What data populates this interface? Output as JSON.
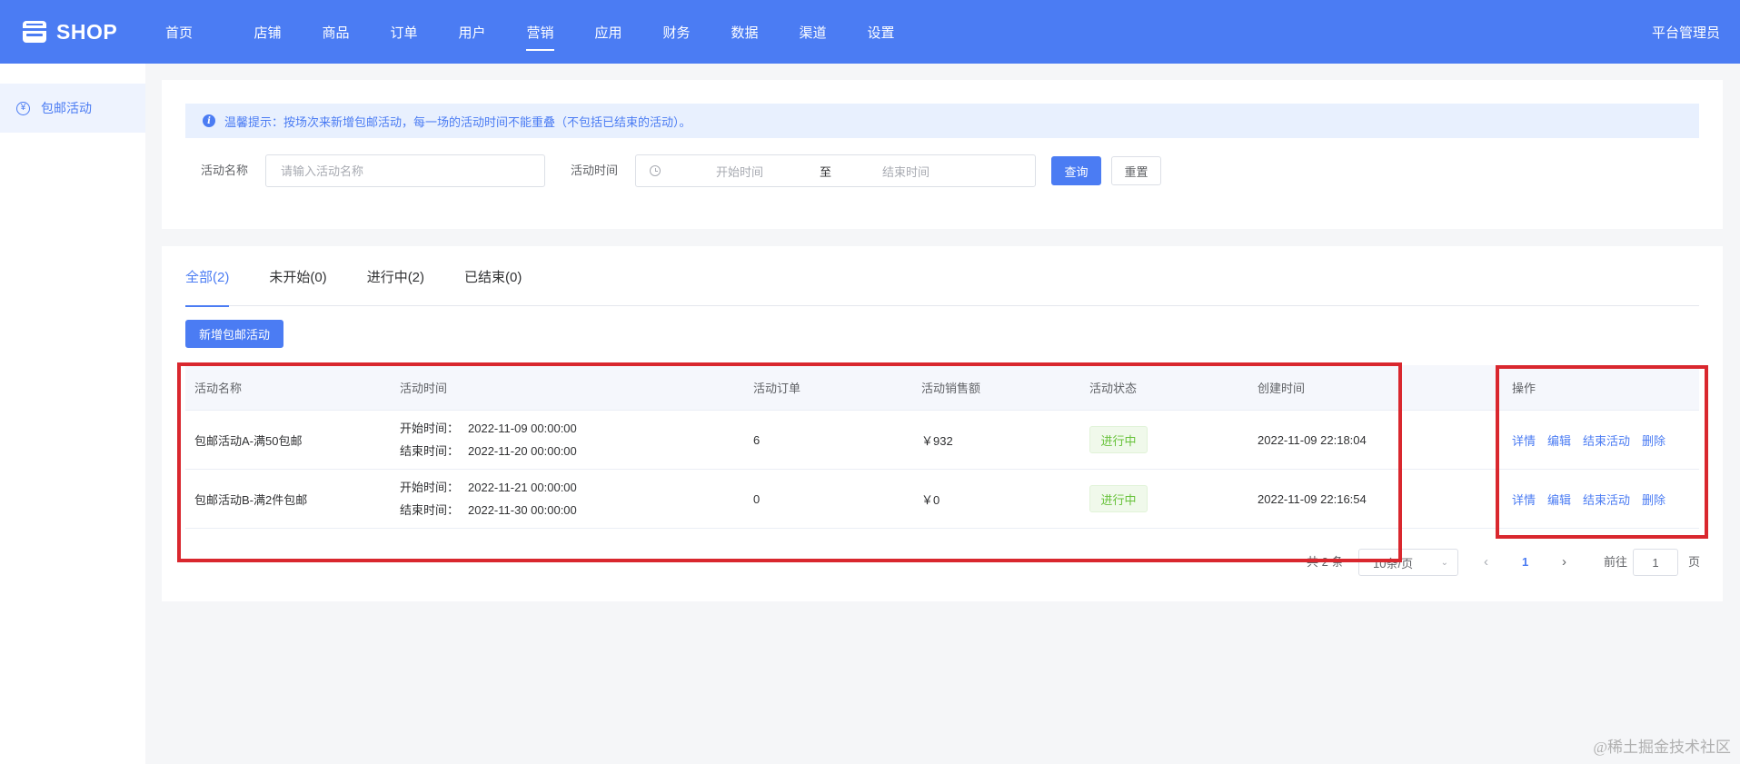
{
  "app": {
    "logo_text": "SHOP",
    "admin_label": "平台管理员",
    "colors": {
      "primary": "#4b7cf3",
      "success": "#67c23a",
      "annotation": "#d9272e"
    }
  },
  "nav": {
    "items": [
      "首页",
      "店铺",
      "商品",
      "订单",
      "用户",
      "营销",
      "应用",
      "财务",
      "数据",
      "渠道",
      "设置"
    ],
    "active": "营销"
  },
  "sidebar": {
    "items": [
      {
        "label": "包邮活动",
        "icon": "yen-circle-icon",
        "active": true
      }
    ]
  },
  "filter": {
    "tip": "温馨提示：按场次来新增包邮活动，每一场的活动时间不能重叠（不包括已结束的活动）。",
    "name_label": "活动名称",
    "name_placeholder": "请输入活动名称",
    "time_label": "活动时间",
    "start_placeholder": "开始时间",
    "range_sep": "至",
    "end_placeholder": "结束时间",
    "query_button": "查询",
    "reset_button": "重置"
  },
  "tabs": [
    {
      "label": "全部(2)",
      "active": true
    },
    {
      "label": "未开始(0)",
      "active": false
    },
    {
      "label": "进行中(2)",
      "active": false
    },
    {
      "label": "已结束(0)",
      "active": false
    }
  ],
  "add_button": "新增包邮活动",
  "table": {
    "columns": [
      "活动名称",
      "活动时间",
      "活动订单",
      "活动销售额",
      "活动状态",
      "创建时间",
      "操作"
    ],
    "start_prefix": "开始时间：",
    "end_prefix": "结束时间：",
    "rows": [
      {
        "name": "包邮活动A-满50包邮",
        "start": "2022-11-09 00:00:00",
        "end": "2022-11-20 00:00:00",
        "orders": "6",
        "sales": "￥932",
        "status": "进行中",
        "created": "2022-11-09 22:18:04",
        "actions": [
          "详情",
          "编辑",
          "结束活动",
          "删除"
        ]
      },
      {
        "name": "包邮活动B-满2件包邮",
        "start": "2022-11-21 00:00:00",
        "end": "2022-11-30 00:00:00",
        "orders": "0",
        "sales": "￥0",
        "status": "进行中",
        "created": "2022-11-09 22:16:54",
        "actions": [
          "详情",
          "编辑",
          "结束活动",
          "删除"
        ]
      }
    ]
  },
  "pagination": {
    "total": "共 2 条",
    "page_size": "10条/页",
    "current": "1",
    "goto_label": "前往",
    "goto_value": "1",
    "page_suffix": "页"
  },
  "watermark": "@稀土掘金技术社区"
}
